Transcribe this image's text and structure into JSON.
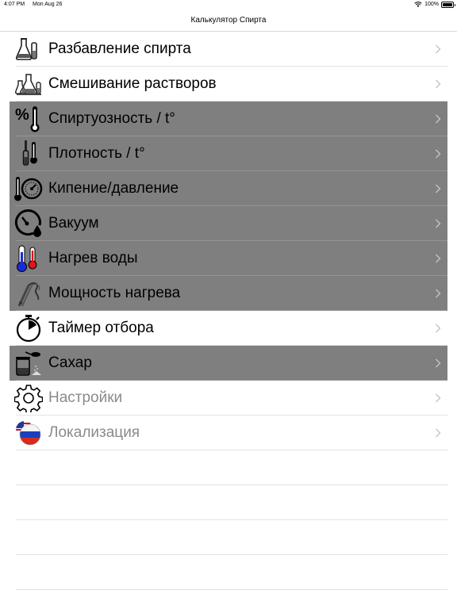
{
  "status": {
    "time": "4:07 PM",
    "date": "Mon Aug 26",
    "battery": "100%"
  },
  "nav": {
    "title": "Калькулятор Спирта"
  },
  "menu": [
    {
      "label": "Разбавление спирта",
      "icon": "flasks-icon",
      "enabled": true
    },
    {
      "label": "Смешивание растворов",
      "icon": "mixing-flasks-icon",
      "enabled": true
    },
    {
      "label": "Спиртуозность / t°",
      "icon": "percent-thermometer-icon",
      "enabled": false
    },
    {
      "label": "Плотность / t°",
      "icon": "hydrometer-thermometer-icon",
      "enabled": false
    },
    {
      "label": "Кипение/давление",
      "icon": "thermometer-pressure-gauge-icon",
      "enabled": false
    },
    {
      "label": "Вакуум",
      "icon": "vacuum-gauge-icon",
      "enabled": false
    },
    {
      "label": "Нагрев воды",
      "icon": "blue-red-thermometers-icon",
      "enabled": false
    },
    {
      "label": "Мощность нагрева",
      "icon": "heating-element-icon",
      "enabled": false
    },
    {
      "label": "Таймер отбора",
      "icon": "stopwatch-icon",
      "enabled": true
    },
    {
      "label": "Сахар",
      "icon": "sugar-jar-icon",
      "enabled": false
    },
    {
      "label": "Настройки",
      "icon": "gear-icon",
      "enabled": true,
      "muted": true
    },
    {
      "label": "Локализация",
      "icon": "flag-globe-icon",
      "enabled": true,
      "muted": true
    }
  ]
}
